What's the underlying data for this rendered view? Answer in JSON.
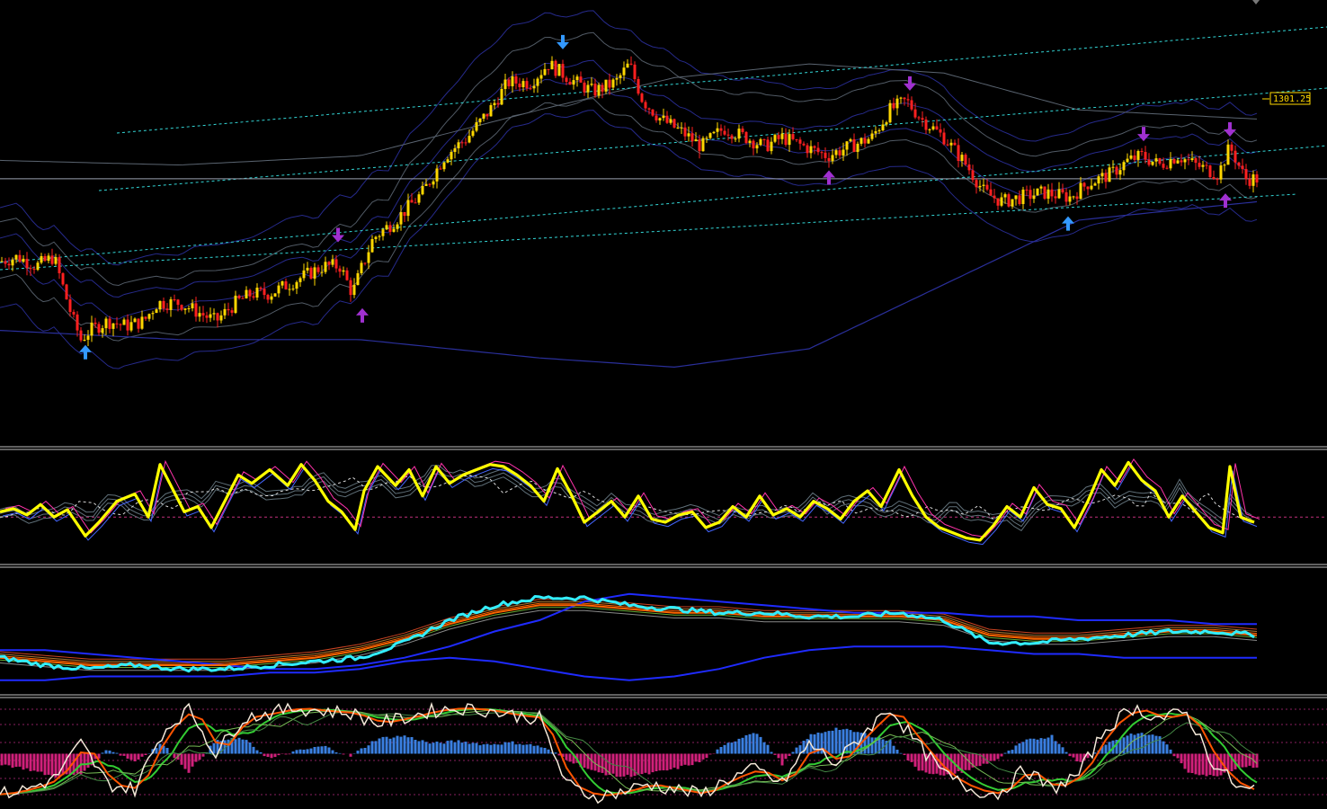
{
  "platform": "trading-terminal",
  "price_marker": {
    "value": "1301.25"
  },
  "colors": {
    "background": "#000000",
    "separator": "#c0c0c0",
    "bull_candle": "#ffd700",
    "bear_candle": "#ff2020",
    "channel": "#33d6d6",
    "horizontal_level": "#9aa0b0",
    "envelope_blue": "#2a2f9a",
    "envelope_gray": "#5a6470",
    "arrow_blue": "#3399ff",
    "arrow_purple": "#a030d0",
    "osc_yellow": "#ffff00",
    "osc_blue": "#4466ff",
    "osc_magenta": "#ff33aa",
    "ma_cyan": "#33eeff",
    "ma_orange": "#ff6600",
    "ma_blue": "#1f2bff",
    "hist_blue": "#3a7fe0",
    "hist_magenta": "#d0207a",
    "stoch_white": "#f4e8d8",
    "stoch_orange": "#ff5500",
    "stoch_green": "#33cc33"
  },
  "chart_data": [
    {
      "type": "line",
      "name": "price",
      "subtype": "candlestick",
      "x": [
        0,
        20,
        40,
        60,
        80,
        90,
        100,
        120,
        140,
        160,
        175,
        200,
        220,
        240,
        262,
        280,
        300,
        320,
        340,
        360,
        378,
        392,
        403,
        415,
        440,
        470,
        495,
        520,
        545,
        565,
        590,
        610,
        625,
        640,
        660,
        685,
        700,
        715,
        735,
        760,
        780,
        805,
        830,
        850,
        870,
        895,
        920,
        945,
        970,
        990,
        1008,
        1025,
        1050,
        1075,
        1095,
        1115,
        1135,
        1160,
        1190,
        1210,
        1235,
        1255,
        1270,
        1290,
        1310,
        1330,
        1355,
        1368,
        1385,
        1398
      ],
      "y": [
        1267,
        1268,
        1266,
        1268,
        1255,
        1250,
        1252,
        1254,
        1253,
        1254,
        1258,
        1258,
        1256,
        1254,
        1258,
        1260,
        1260,
        1262,
        1264,
        1266,
        1266,
        1260,
        1266,
        1272,
        1276,
        1282,
        1290,
        1294,
        1300,
        1306,
        1306,
        1310,
        1308,
        1306,
        1304,
        1306,
        1310,
        1302,
        1298,
        1295,
        1292,
        1296,
        1294,
        1292,
        1294,
        1292,
        1290,
        1292,
        1294,
        1300,
        1302,
        1298,
        1294,
        1288,
        1282,
        1280,
        1281,
        1282,
        1281,
        1284,
        1286,
        1289,
        1290,
        1288,
        1290,
        1288,
        1286,
        1292,
        1285,
        1285
      ],
      "ylim": [
        1230,
        1320
      ],
      "arrows_up": [
        {
          "x": 95,
          "y": 1250
        },
        {
          "x": 403,
          "y": 1258
        },
        {
          "x": 922,
          "y": 1288
        },
        {
          "x": 1188,
          "y": 1278
        },
        {
          "x": 1363,
          "y": 1283
        }
      ],
      "arrows_down": [
        {
          "x": 376,
          "y": 1270
        },
        {
          "x": 626,
          "y": 1312
        },
        {
          "x": 1012,
          "y": 1303
        },
        {
          "x": 1272,
          "y": 1292
        },
        {
          "x": 1368,
          "y": 1293
        }
      ],
      "horizontal_level": 1285
    },
    {
      "type": "line",
      "name": "oscillator",
      "x": [
        0,
        15,
        30,
        45,
        60,
        75,
        95,
        110,
        130,
        150,
        165,
        178,
        190,
        205,
        220,
        235,
        250,
        265,
        280,
        300,
        320,
        335,
        350,
        365,
        380,
        395,
        405,
        420,
        440,
        455,
        470,
        485,
        500,
        515,
        530,
        545,
        560,
        575,
        590,
        605,
        620,
        635,
        650,
        665,
        680,
        695,
        710,
        725,
        740,
        755,
        770,
        785,
        800,
        815,
        830,
        845,
        860,
        875,
        890,
        905,
        920,
        935,
        950,
        965,
        980,
        1000,
        1015,
        1030,
        1045,
        1060,
        1075,
        1090,
        1105,
        1120,
        1135,
        1150,
        1165,
        1180,
        1195,
        1210,
        1225,
        1240,
        1255,
        1270,
        1285,
        1300,
        1315,
        1330,
        1345,
        1360,
        1368,
        1380,
        1395
      ],
      "y": [
        45,
        48,
        42,
        52,
        40,
        47,
        22,
        35,
        55,
        62,
        40,
        90,
        70,
        45,
        50,
        30,
        55,
        80,
        72,
        85,
        70,
        90,
        75,
        55,
        45,
        28,
        65,
        88,
        70,
        85,
        60,
        88,
        72,
        80,
        85,
        90,
        88,
        80,
        70,
        55,
        86,
        62,
        35,
        45,
        55,
        40,
        60,
        38,
        35,
        42,
        45,
        30,
        35,
        50,
        40,
        60,
        42,
        48,
        40,
        55,
        48,
        38,
        55,
        65,
        50,
        85,
        60,
        40,
        30,
        25,
        20,
        18,
        32,
        50,
        40,
        68,
        52,
        48,
        30,
        55,
        85,
        70,
        92,
        75,
        65,
        40,
        60,
        45,
        30,
        25,
        88,
        40,
        35
      ],
      "ylim": [
        0,
        100
      ],
      "signal_level": 40
    },
    {
      "type": "line",
      "name": "moving_averages",
      "x": [
        0,
        50,
        100,
        150,
        200,
        250,
        300,
        350,
        400,
        450,
        500,
        550,
        600,
        650,
        700,
        750,
        800,
        850,
        900,
        950,
        1000,
        1050,
        1100,
        1150,
        1200,
        1250,
        1300,
        1350,
        1398
      ],
      "series": [
        {
          "values": [
            1288,
            1286,
            1285,
            1286,
            1285,
            1285,
            1286,
            1287,
            1288,
            1292,
            1298,
            1302,
            1304,
            1304,
            1302,
            1301,
            1300,
            1300,
            1299,
            1299,
            1300,
            1298,
            1292,
            1292,
            1293,
            1294,
            1295,
            1295,
            1294
          ]
        },
        {
          "values": [
            1288,
            1287,
            1286,
            1286,
            1286,
            1286,
            1287,
            1288,
            1290,
            1293,
            1297,
            1300,
            1302,
            1302,
            1301,
            1300,
            1300,
            1299,
            1299,
            1299,
            1299,
            1298,
            1294,
            1293,
            1293,
            1294,
            1295,
            1295,
            1294
          ]
        },
        {
          "values": [
            1290,
            1290,
            1289,
            1288,
            1287,
            1286,
            1285,
            1285,
            1286,
            1288,
            1291,
            1295,
            1298,
            1303,
            1305,
            1304,
            1303,
            1302,
            1301,
            1300,
            1300,
            1300,
            1299,
            1299,
            1298,
            1298,
            1298,
            1297,
            1297
          ]
        }
      ],
      "ylim": [
        1280,
        1310
      ]
    },
    {
      "type": "bar",
      "name": "histogram_stochastic",
      "x": [
        0,
        30,
        60,
        90,
        120,
        150,
        180,
        210,
        240,
        270,
        300,
        330,
        360,
        390,
        420,
        450,
        480,
        510,
        540,
        570,
        600,
        630,
        660,
        690,
        720,
        750,
        780,
        810,
        840,
        870,
        900,
        930,
        960,
        990,
        1020,
        1050,
        1080,
        1110,
        1140,
        1170,
        1200,
        1230,
        1260,
        1290,
        1320,
        1350,
        1380
      ],
      "values": [
        -20,
        -30,
        -45,
        -40,
        10,
        -15,
        20,
        -35,
        25,
        30,
        -10,
        5,
        15,
        -5,
        30,
        35,
        20,
        25,
        18,
        22,
        15,
        -10,
        -35,
        -45,
        -40,
        -30,
        -15,
        20,
        45,
        -20,
        35,
        50,
        40,
        25,
        -30,
        -45,
        -30,
        -10,
        25,
        35,
        -20,
        20,
        40,
        35,
        -35,
        -45,
        -25
      ],
      "stochastic": [
        10,
        15,
        25,
        60,
        20,
        15,
        70,
        95,
        50,
        85,
        90,
        95,
        92,
        90,
        80,
        85,
        92,
        95,
        93,
        88,
        85,
        20,
        8,
        12,
        20,
        15,
        10,
        25,
        35,
        20,
        60,
        40,
        70,
        95,
        60,
        30,
        15,
        10,
        35,
        15,
        30,
        75,
        95,
        85,
        90,
        40,
        15
      ],
      "ylim": [
        -100,
        100
      ]
    }
  ]
}
